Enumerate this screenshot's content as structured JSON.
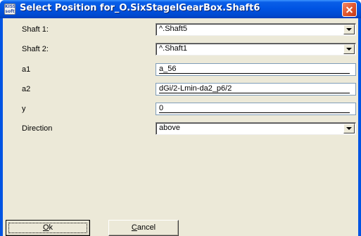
{
  "window": {
    "title": "Select Position for_O.SixStagelGearBox.Shaft6",
    "icon_text": [
      "KISS",
      "soft"
    ]
  },
  "form": {
    "shaft1": {
      "label": "Shaft 1:",
      "value": "^.Shaft5"
    },
    "shaft2": {
      "label": "Shaft 2:",
      "value": "^.Shaft1"
    },
    "a1": {
      "label": "a1",
      "value": "a_56"
    },
    "a2": {
      "label": "a2",
      "value": "dGi/2-Lmin-da2_p6/2"
    },
    "y": {
      "label": "y",
      "value": "0"
    },
    "direction": {
      "label": "Direction",
      "value": "above"
    }
  },
  "buttons": {
    "ok": {
      "mnemonic": "O",
      "rest": "k"
    },
    "cancel": {
      "mnemonic": "C",
      "rest": "ancel"
    }
  },
  "colors": {
    "titlebar": "#0054e3",
    "client_bg": "#ece9d8",
    "close_button": "#e2582e"
  }
}
